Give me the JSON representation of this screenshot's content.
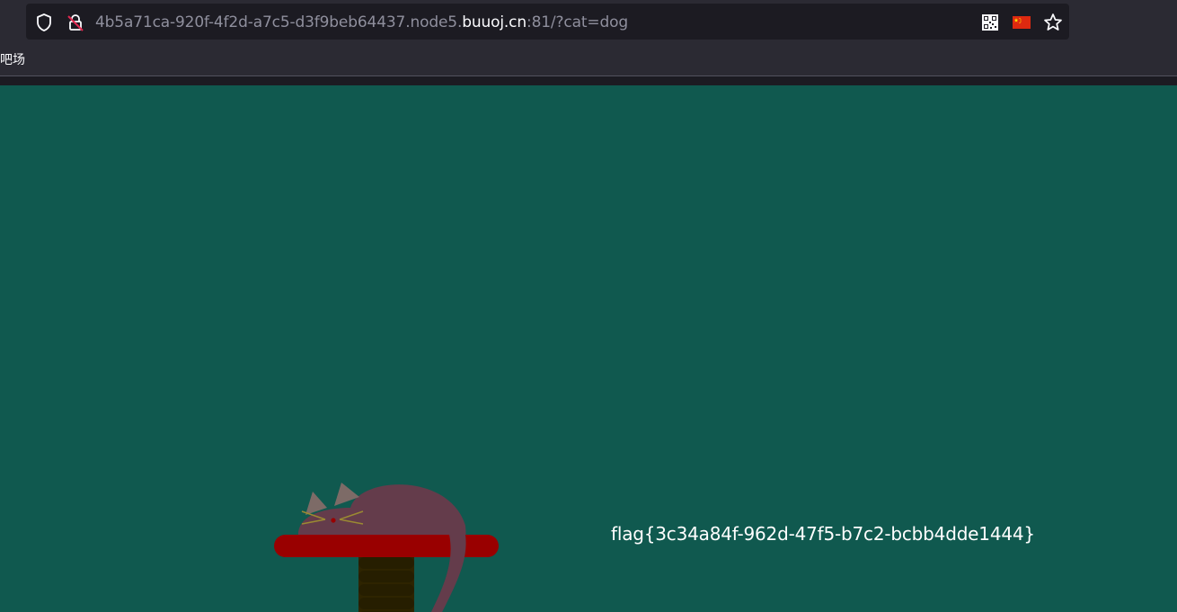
{
  "browser": {
    "url_prefix": "4b5a71ca-920f-4f2d-a7c5-d3f9beb64437.node5.",
    "url_host": "buuoj.cn",
    "url_suffix": ":81/?cat=dog",
    "icons": [
      "shield-icon",
      "insecure-lock-icon",
      "qr-code-icon",
      "flag-china-icon",
      "star-bookmark-icon"
    ],
    "bookmark_label": "吧场"
  },
  "page": {
    "flag_text": "flag{3c34a84f-962d-47f5-b7c2-bcbb4dde1444}",
    "background_color": "#10594f",
    "cat_color": "#643c4b",
    "perch_color": "#990000",
    "post_color": "#2e2400"
  }
}
